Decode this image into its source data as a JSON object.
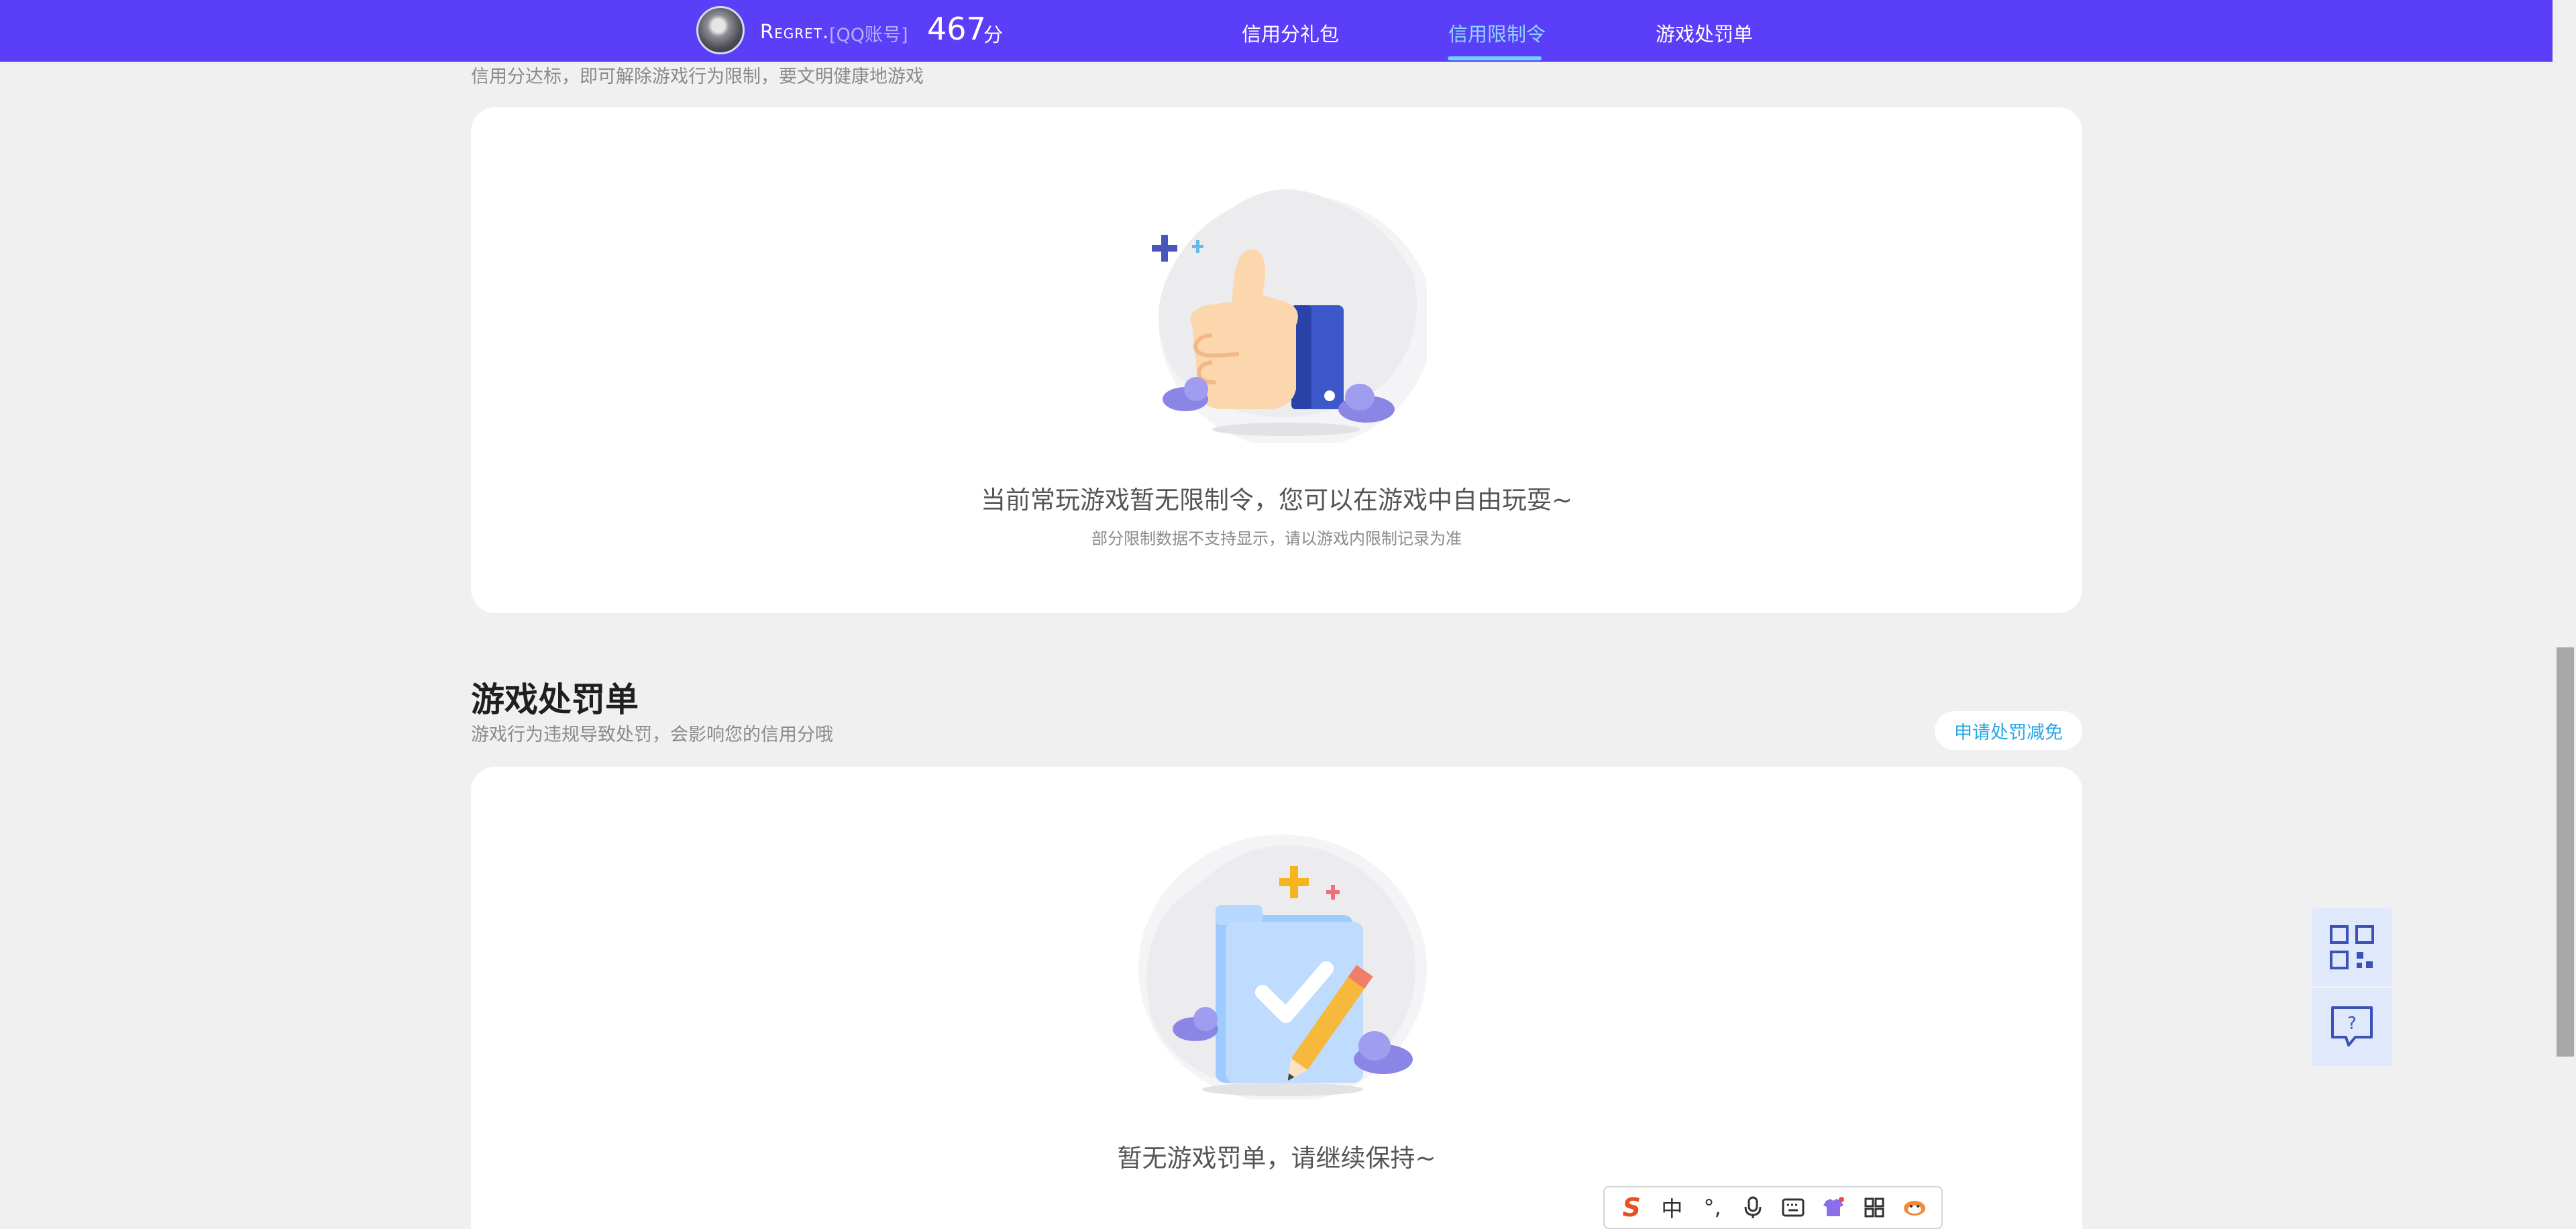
{
  "header": {
    "username": "Regret.",
    "account_type": "[QQ账号]",
    "score": "467",
    "score_unit": "分",
    "tabs": [
      {
        "label": "信用分礼包",
        "active": false
      },
      {
        "label": "信用限制令",
        "active": true
      },
      {
        "label": "游戏处罚单",
        "active": false
      }
    ]
  },
  "restriction_section": {
    "subtitle": "信用分达标，即可解除游戏行为限制，要文明健康地游戏",
    "empty_message": "当前常玩游戏暂无限制令，您可以在游戏中自由玩耍~",
    "empty_note": "部分限制数据不支持显示，请以游戏内限制记录为准"
  },
  "penalty_section": {
    "title": "游戏处罚单",
    "subtitle": "游戏行为违规导致处罚，会影响您的信用分哦",
    "apply_button": "申请处罚减免",
    "empty_message": "暂无游戏罚单，请继续保持~"
  },
  "side_buttons": [
    {
      "icon": "qr-code-icon"
    },
    {
      "icon": "question-chat-icon"
    }
  ],
  "ime_toolbar": {
    "logo": "S",
    "mode": "中",
    "punct": "°,",
    "items": [
      "sogou-logo-icon",
      "chinese-mode-icon",
      "punctuation-icon",
      "microphone-icon",
      "keyboard-icon",
      "skin-icon",
      "toolbox-icon",
      "mascot-icon"
    ]
  },
  "colors": {
    "brand": "#5b3ef7",
    "active_tab": "#8fd8ff",
    "link": "#27a8e6",
    "page_bg": "#f0f0f0"
  }
}
